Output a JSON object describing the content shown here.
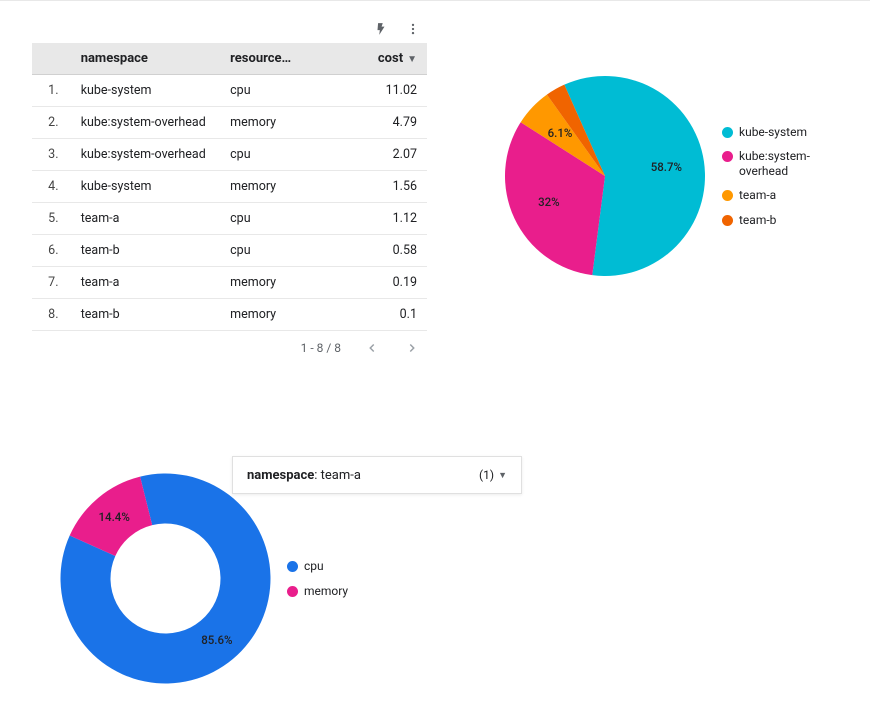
{
  "colors": {
    "teal": "#00bcd4",
    "pink": "#e91e8c",
    "orange": "#ff9800",
    "darkorange": "#f06400",
    "blue": "#1a73e8"
  },
  "table": {
    "headers": {
      "namespace": "namespace",
      "resource": "resource…",
      "cost": "cost"
    },
    "rows": [
      {
        "n": "1.",
        "namespace": "kube-system",
        "resource": "cpu",
        "cost": "11.02"
      },
      {
        "n": "2.",
        "namespace": "kube:system-overhead",
        "resource": "memory",
        "cost": "4.79"
      },
      {
        "n": "3.",
        "namespace": "kube:system-overhead",
        "resource": "cpu",
        "cost": "2.07"
      },
      {
        "n": "4.",
        "namespace": "kube-system",
        "resource": "memory",
        "cost": "1.56"
      },
      {
        "n": "5.",
        "namespace": "team-a",
        "resource": "cpu",
        "cost": "1.12"
      },
      {
        "n": "6.",
        "namespace": "team-b",
        "resource": "cpu",
        "cost": "0.58"
      },
      {
        "n": "7.",
        "namespace": "team-a",
        "resource": "memory",
        "cost": "0.19"
      },
      {
        "n": "8.",
        "namespace": "team-b",
        "resource": "memory",
        "cost": "0.1"
      }
    ],
    "pager": "1 - 8 / 8"
  },
  "filter": {
    "field": "namespace",
    "value": "team-a",
    "count": "(1)"
  },
  "chart_data": [
    {
      "type": "pie",
      "title": "",
      "series": [
        {
          "name": "kube-system",
          "value": 58.7,
          "label": "58.7%",
          "color": "#00bcd4"
        },
        {
          "name": "kube:system-overhead",
          "value": 32.0,
          "label": "32%",
          "color": "#e91e8c"
        },
        {
          "name": "team-a",
          "value": 6.1,
          "label": "6.1%",
          "color": "#ff9800"
        },
        {
          "name": "team-b",
          "value": 3.2,
          "label": "",
          "color": "#f06400"
        }
      ]
    },
    {
      "type": "donut",
      "title": "",
      "series": [
        {
          "name": "cpu",
          "value": 85.6,
          "label": "85.6%",
          "color": "#1a73e8"
        },
        {
          "name": "memory",
          "value": 14.4,
          "label": "14.4%",
          "color": "#e91e8c"
        }
      ]
    }
  ]
}
